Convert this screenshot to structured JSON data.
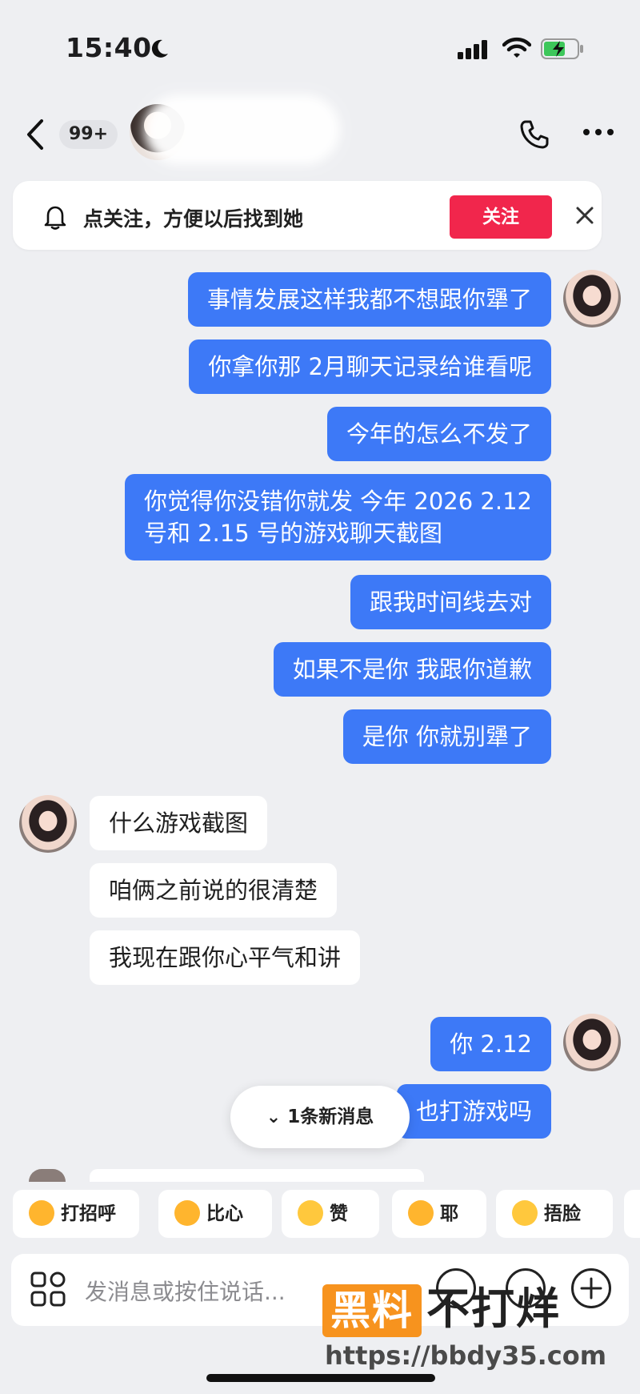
{
  "status_bar": {
    "time": "15:40"
  },
  "header": {
    "unread_badge": "99+"
  },
  "follow_banner": {
    "text": "点关注，方便以后找到她",
    "button": "关注"
  },
  "messages": [
    {
      "from": "me",
      "text": "事情发展这样我都不想跟你犟了"
    },
    {
      "from": "me",
      "text": "你拿你那 2月聊天记录给谁看呢"
    },
    {
      "from": "me",
      "text": "今年的怎么不发了"
    },
    {
      "from": "me",
      "lines": [
        "你觉得你没错你就发 今年 2026 2.12",
        "号和 2.15 号的游戏聊天截图"
      ]
    },
    {
      "from": "me",
      "text": "跟我时间线去对"
    },
    {
      "from": "me",
      "text": "如果不是你 我跟你道歉"
    },
    {
      "from": "me",
      "text": "是你 你就别犟了"
    },
    {
      "from": "them",
      "text": "什么游戏截图"
    },
    {
      "from": "them",
      "text": "咱俩之前说的很清楚"
    },
    {
      "from": "them",
      "text": "我现在跟你心平气和讲"
    },
    {
      "from": "me",
      "text": "你 2.12"
    },
    {
      "from": "me",
      "text": "也打游戏吗"
    }
  ],
  "new_messages_pill": "1条新消息",
  "quick_replies": [
    {
      "label": "打招呼",
      "icon": "wave-emoji-icon"
    },
    {
      "label": "比心",
      "icon": "heart-hands-emoji-icon"
    },
    {
      "label": "赞",
      "icon": "thumbs-up-emoji-icon"
    },
    {
      "label": "耶",
      "icon": "victory-emoji-icon"
    },
    {
      "label": "捂脸",
      "icon": "facepalm-emoji-icon"
    }
  ],
  "input": {
    "placeholder": "发消息或按住说话..."
  },
  "watermark": {
    "brand": "黑料",
    "text": "不打烊",
    "url": "https://bbdy35.com"
  },
  "colors": {
    "my_bubble": "#3d79f7",
    "follow_button": "#f1264c",
    "watermark": "#f7931e"
  }
}
